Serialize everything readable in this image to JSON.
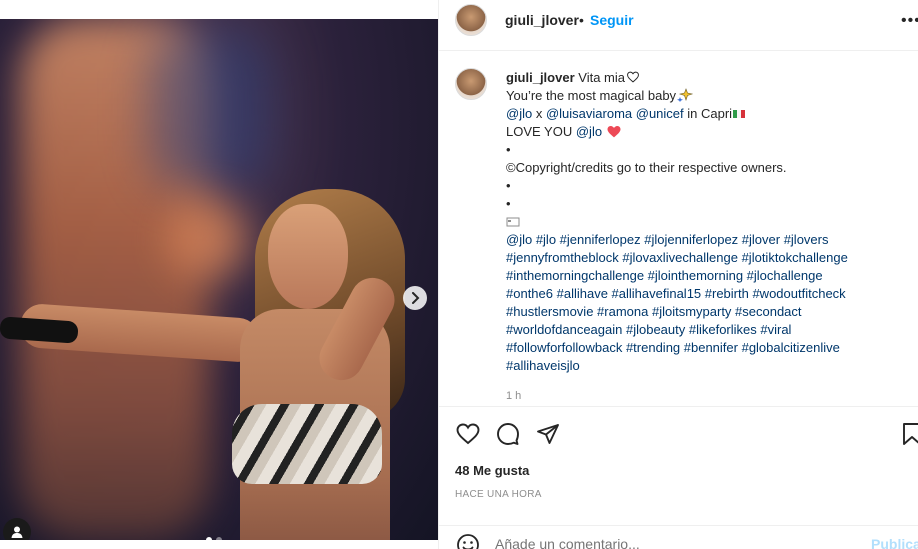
{
  "post": {
    "username": "giuli_jlover",
    "separator": "•",
    "follow_label": "Seguir",
    "more_label": "•••"
  },
  "caption": {
    "username": "giuli_jlover",
    "line1": "Vita mia",
    "line2": "You’re the most magical baby",
    "line3_mentions": [
      "@jlo",
      "@luisaviaroma",
      "@unicef"
    ],
    "line3_x": "x",
    "line3_in": "in Capri",
    "line4_text": "LOVE YOU",
    "line4_mention": "@jlo",
    "bullet": "•",
    "copyright": "©Copyright/credits go to their respective owners.",
    "hashtag_lines": [
      "@jlo #jlo #jenniferlopez #jlojenniferlopez #jlover #jlovers",
      "#jennyfromtheblock #jlovaxlivechallenge #jlotiktokchallenge",
      "#inthemorningchallenge #jlointhemorning #jlochallenge",
      "#onthe6 #allihave #allihavefinal15 #rebirth #wodoutfitcheck",
      "#hustlersmovie #ramona #jloitsmyparty #secondact",
      "#worldofdanceagain #jlobeauty #likeforlikes #viral",
      "#followforfollowback #trending #bennifer #globalcitizenlive",
      "#allihaveisjlo"
    ],
    "time": "1 h"
  },
  "engagement": {
    "likes": "48 Me gusta",
    "posted_ago": "HACE UNA HORA"
  },
  "comment": {
    "placeholder": "Añade un comentario...",
    "publish_label": "Publicar"
  },
  "icons": {
    "like": "heart-icon",
    "comment": "comment-icon",
    "share": "paper-plane-icon",
    "save": "bookmark-icon",
    "emoji": "smiley-icon",
    "next": "chevron-right-icon",
    "tag": "user-tag-icon"
  },
  "carousel": {
    "count": 2,
    "active": 1
  },
  "colors": {
    "link": "#00376b",
    "follow": "#0095f6",
    "publish_disabled": "#b2dffc",
    "heart_emoji": "#ed4956"
  }
}
